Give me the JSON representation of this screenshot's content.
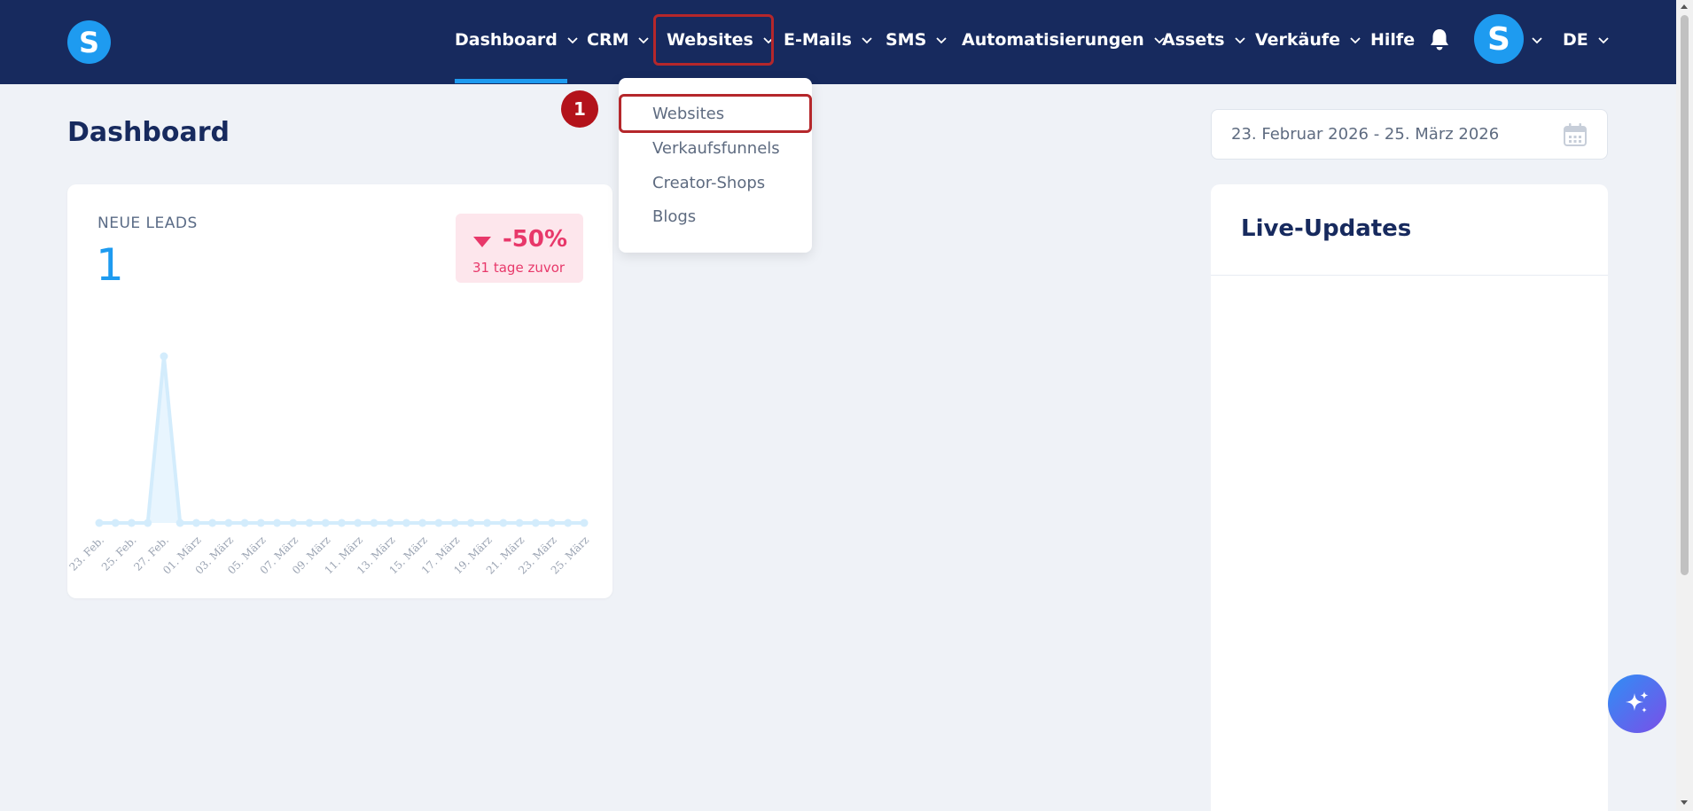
{
  "brand": {
    "logo_letter": "S"
  },
  "nav": {
    "items": [
      {
        "label": "Dashboard",
        "has_chevron": true
      },
      {
        "label": "CRM",
        "has_chevron": true
      },
      {
        "label": "Websites",
        "has_chevron": true
      },
      {
        "label": "E-Mails",
        "has_chevron": true
      },
      {
        "label": "SMS",
        "has_chevron": true
      },
      {
        "label": "Automatisierungen",
        "has_chevron": true
      },
      {
        "label": "Assets",
        "has_chevron": true
      },
      {
        "label": "Verkäufe",
        "has_chevron": true
      },
      {
        "label": "Hilfe",
        "has_chevron": false
      }
    ],
    "active": "Dashboard",
    "highlighted": "Websites",
    "avatar_letter": "S",
    "language": "DE"
  },
  "dropdown": {
    "items": [
      "Websites",
      "Verkaufsfunnels",
      "Creator-Shops",
      "Blogs"
    ],
    "highlighted": "Websites",
    "step_number": "1"
  },
  "page": {
    "title": "Dashboard",
    "date_range": "23. Februar 2026 - 25. März 2026"
  },
  "leads_card": {
    "label": "NEUE LEADS",
    "value": "1",
    "change": "-50%",
    "change_sub": "31 tage zuvor"
  },
  "live_updates": {
    "title": "Live-Updates"
  },
  "colors": {
    "nav_bg": "#172a5e",
    "accent": "#1e9bf0",
    "negative": "#e8386a",
    "highlight_border": "#b5272b"
  },
  "chart_data": {
    "type": "area",
    "x": [
      "23. Feb.",
      "24. Feb.",
      "25. Feb.",
      "26. Feb.",
      "27. Feb.",
      "28. Feb.",
      "01. März",
      "02. März",
      "03. März",
      "04. März",
      "05. März",
      "06. März",
      "07. März",
      "08. März",
      "09. März",
      "10. März",
      "11. März",
      "12. März",
      "13. März",
      "14. März",
      "15. März",
      "16. März",
      "17. März",
      "18. März",
      "19. März",
      "20. März",
      "21. März",
      "22. März",
      "23. März",
      "24. März",
      "25. März"
    ],
    "tick_labels": [
      "23. Feb.",
      "25. Feb.",
      "27. Feb.",
      "01. März",
      "03. März",
      "05. März",
      "07. März",
      "09. März",
      "11. März",
      "13. März",
      "15. März",
      "17. März",
      "19. März",
      "21. März",
      "23. März",
      "25. März"
    ],
    "values": [
      0,
      0,
      0,
      0,
      1,
      0,
      0,
      0,
      0,
      0,
      0,
      0,
      0,
      0,
      0,
      0,
      0,
      0,
      0,
      0,
      0,
      0,
      0,
      0,
      0,
      0,
      0,
      0,
      0,
      0,
      0
    ],
    "ylim": [
      0,
      1
    ],
    "grid": false,
    "color": "#d3ecfc"
  }
}
